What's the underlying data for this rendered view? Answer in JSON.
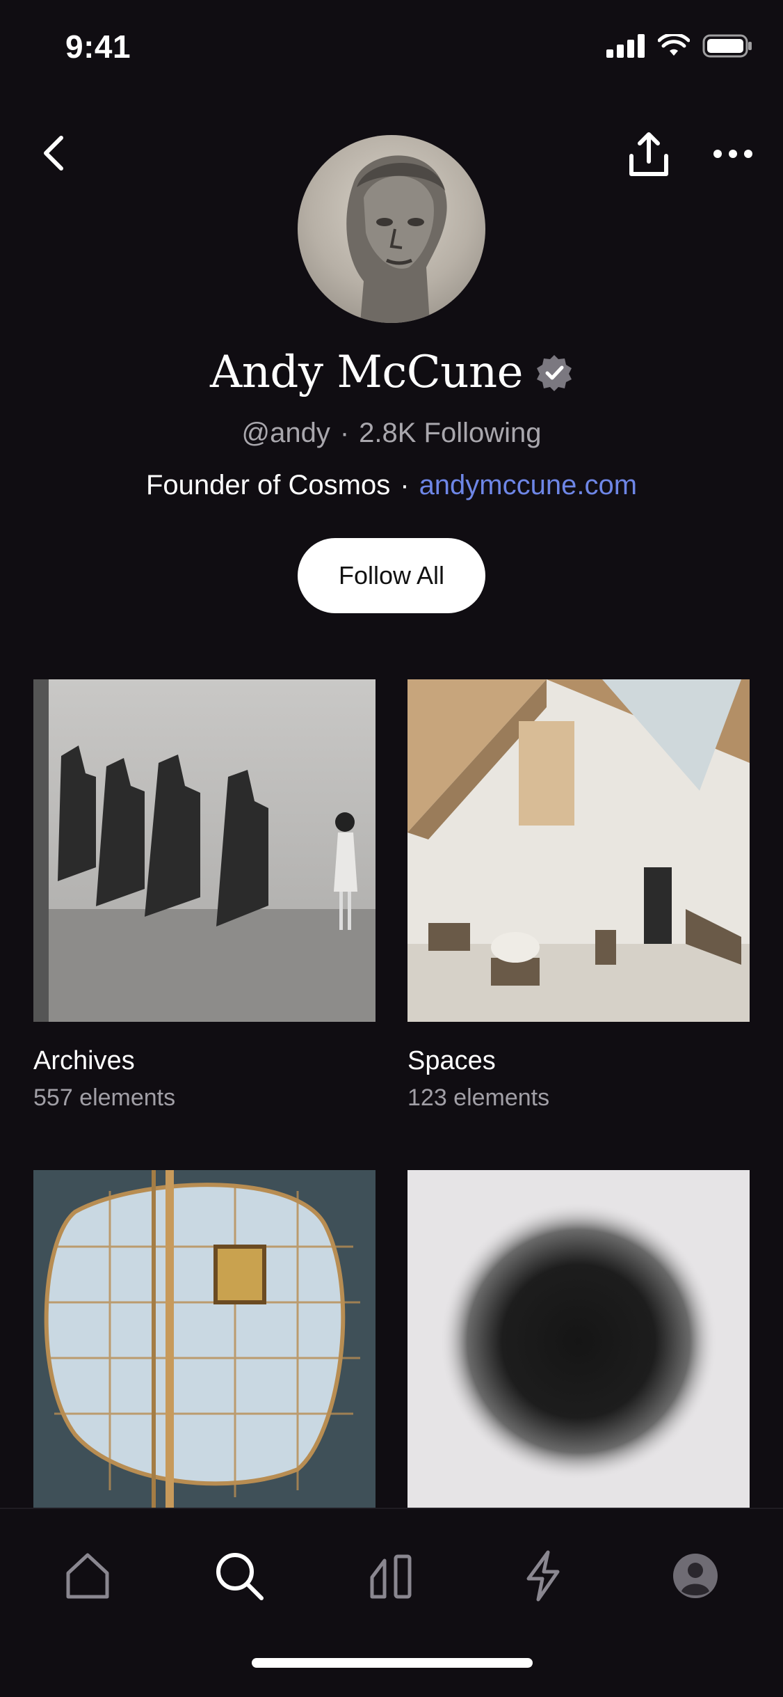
{
  "status_bar": {
    "time": "9:41"
  },
  "profile": {
    "name": "Andy McCune",
    "handle": "@andy",
    "following": "2.8K Following",
    "bio": "Founder of Cosmos",
    "website": "andymccune.com"
  },
  "actions": {
    "follow_all_label": "Follow All"
  },
  "collections": [
    {
      "title": "Archives",
      "count": "557 elements"
    },
    {
      "title": "Spaces",
      "count": "123 elements"
    }
  ],
  "colors": {
    "background": "#100d12",
    "link": "#6e86e6",
    "muted_text": "#a9a7ad"
  },
  "icons": [
    "back-icon",
    "share-icon",
    "more-icon",
    "verified-icon",
    "home-icon",
    "search-icon",
    "library-icon",
    "activity-icon",
    "profile-icon"
  ]
}
